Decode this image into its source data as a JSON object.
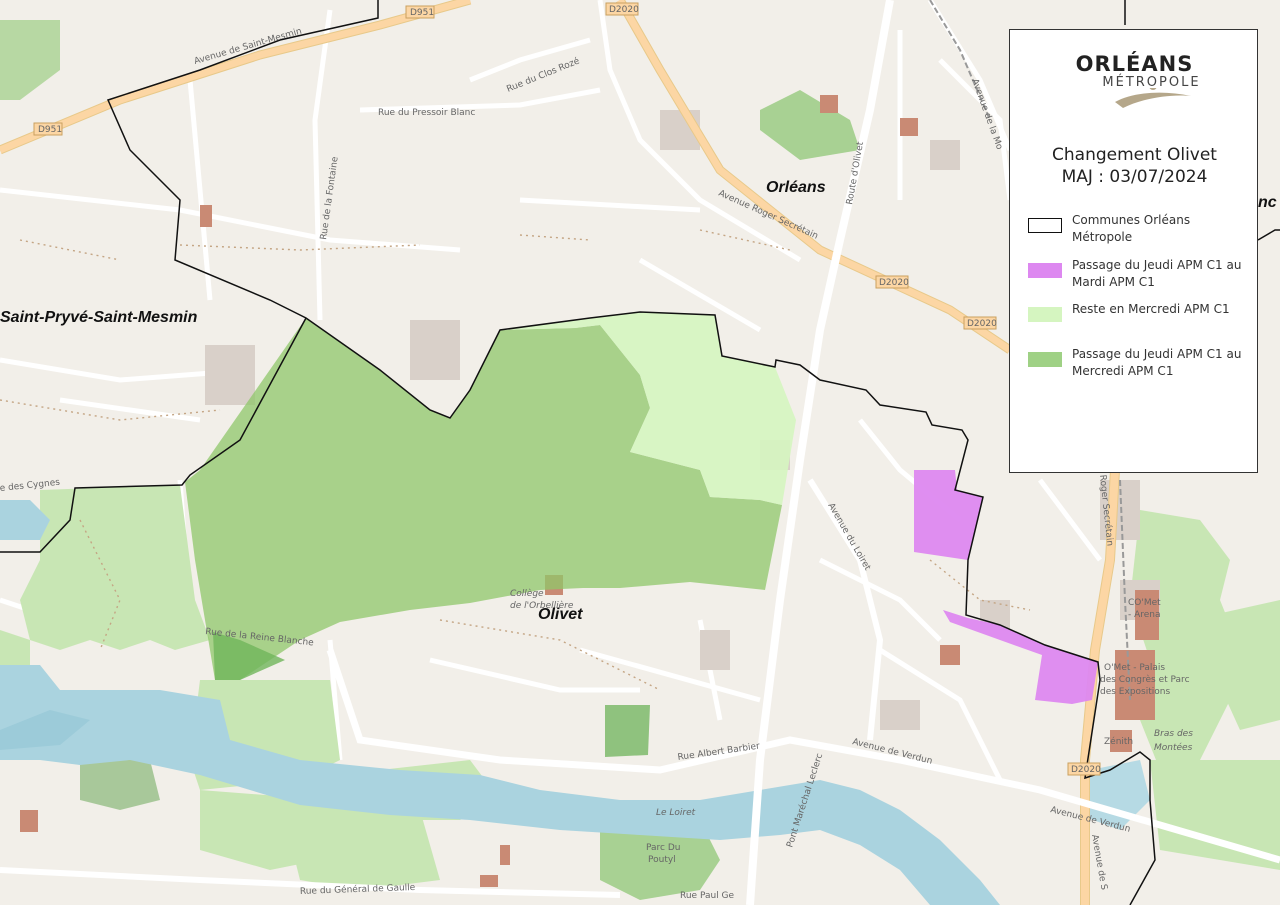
{
  "legend": {
    "logo_main": "ORLÉANS",
    "logo_sub": "MÉTROPOLE",
    "title_line1": "Changement Olivet",
    "title_line2": "MAJ : 03/07/2024",
    "items": [
      {
        "label": "Communes Orléans Métropole",
        "color": "#ffffff"
      },
      {
        "label": "Passage du Jeudi APM C1 au Mardi APM C1",
        "color": "#dd88f0"
      },
      {
        "label": "Reste en Mercredi APM C1",
        "color": "#d5f5c0"
      },
      {
        "label": "Passage du Jeudi APM C1 au Mercredi APM C1",
        "color": "#9fd185"
      }
    ]
  },
  "places": {
    "saint_pryve": "Saint-Pryvé-Saint-Mesmin",
    "orleans": "Orléans",
    "olivet": "Olivet",
    "edge_fragment": "nc"
  },
  "streets": {
    "av_saint_mesmin": "Avenue de Saint-Mesmin",
    "d951_a": "D951",
    "d951_b": "D951",
    "d2020_top": "D2020",
    "d2020_mid": "D2020",
    "d2020_right": "D2020",
    "d2020_bottom": "D2020",
    "rue_pressoir": "Rue du Pressoir Blanc",
    "rue_clos_roze": "Rue du Clos Rozé",
    "rue_fontaine": "Rue de la Fontaine",
    "route_olivet": "Route d'Olivet",
    "av_roger": "Avenue Roger Secrétain",
    "av_roger_right": "Roger Secrétain",
    "av_moulins": "Avenue de la Mo",
    "av_loiret": "Avenue du Loiret",
    "rue_reine": "Rue de la Reine Blanche",
    "rue_cygnes": "e des Cygnes",
    "rue_albert": "Rue Albert Barbier",
    "av_verdun": "Avenue de Verdun",
    "av_verdun_2": "Avenue de Verdun",
    "pont": "Pont Maréchal Leclerc",
    "rue_general": "Rue du Général de Gaulle",
    "rue_paul": "Rue Paul Ge",
    "av_bottom_right": "Avenue de S",
    "college_1": "Collège",
    "college_2": "de l'Orbellière",
    "le_loiret": "Le Loiret",
    "parc_1": "Parc Du",
    "parc_2": "Poutyl",
    "comet_1": "CO'Met",
    "comet_2": "- Arena",
    "omet_1": "O'Met - Palais",
    "omet_2": "des Congrès et Parc",
    "omet_3": "des Expositions",
    "zenith": "Zénith",
    "bras_1": "Bras des",
    "bras_2": "Montées"
  }
}
